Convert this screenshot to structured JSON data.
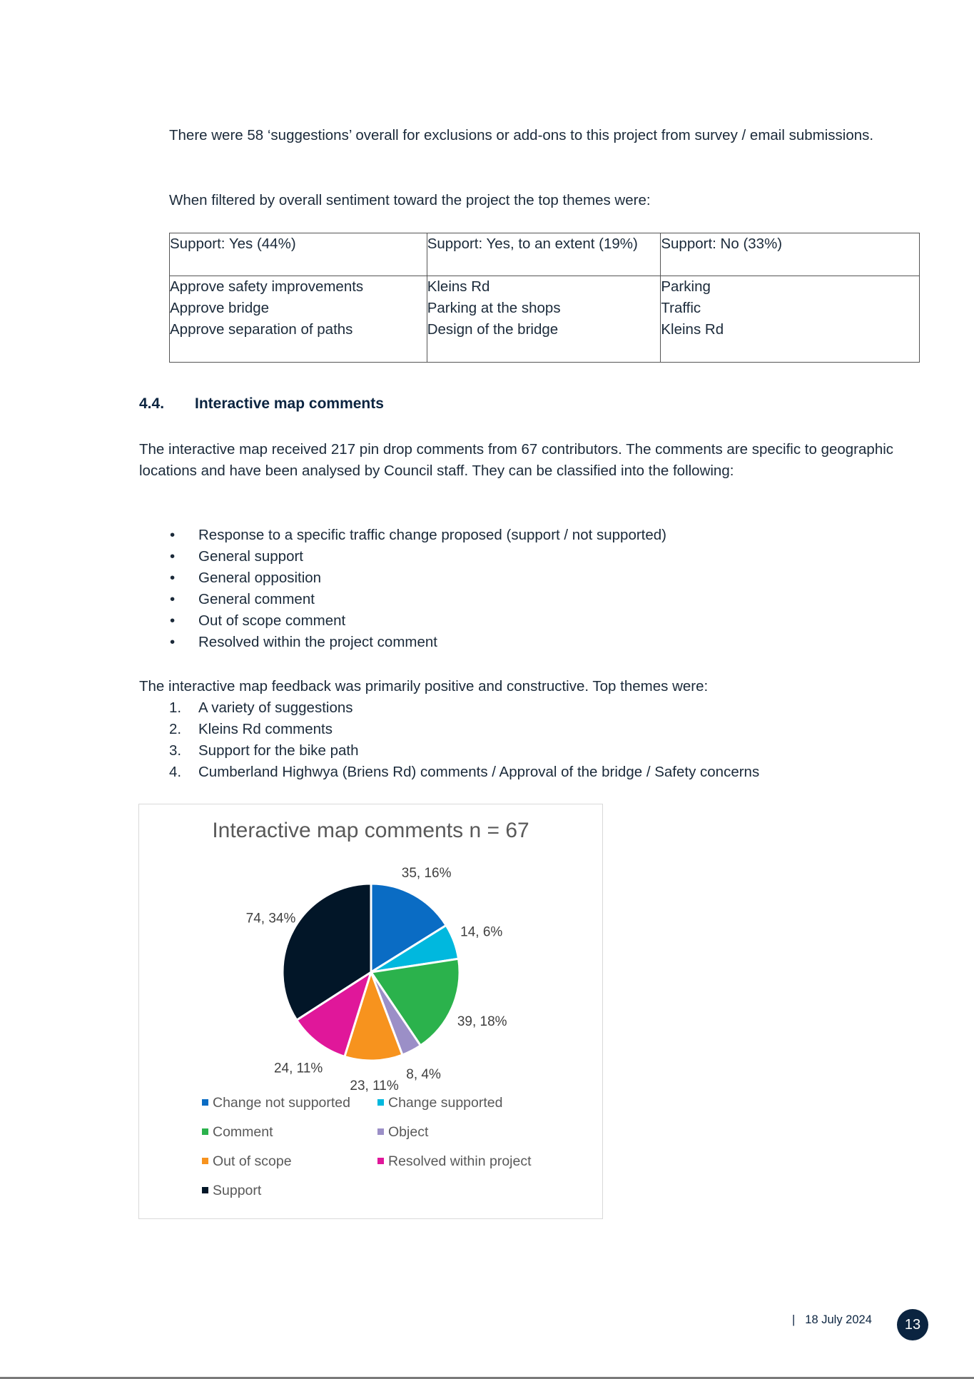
{
  "intro": {
    "paragraph1": "There were 58 ‘suggestions’ overall for exclusions or add-ons to this project from survey / email submissions.",
    "paragraph2": "When filtered by overall sentiment toward the project the top themes were:"
  },
  "themes_table": {
    "headers": [
      "Support: Yes (44%)",
      "Support: Yes, to an extent (19%)",
      "Support: No (33%)"
    ],
    "columns": [
      [
        "Approve safety improvements",
        "Approve bridge",
        "Approve separation of paths"
      ],
      [
        "Kleins Rd",
        "Parking at the shops",
        "Design of the bridge"
      ],
      [
        "Parking",
        "Traffic",
        "Kleins Rd"
      ]
    ]
  },
  "section": {
    "number": "4.4.",
    "title": "Interactive map comments",
    "paragraph": "The interactive map received 217 pin drop comments from 67 contributors. The comments are specific to geographic locations and have been analysed by Council staff. They can be classified into the following:",
    "bullet_glyph": "•",
    "bullets": [
      "Response to a specific traffic change proposed (support / not supported)",
      "General support",
      "General opposition",
      "General comment",
      "Out of scope comment",
      "Resolved within the project comment"
    ],
    "summary": "The interactive map feedback was primarily positive and constructive. Top themes were:",
    "top_themes": [
      {
        "num": "1.",
        "text": "A variety of suggestions"
      },
      {
        "num": "2.",
        "text": "Kleins Rd comments"
      },
      {
        "num": "3.",
        "text": "Support for the bike path"
      },
      {
        "num": "4.",
        "text": "Cumberland Highwya (Briens Rd) comments / Approval of the bridge / Safety concerns"
      }
    ]
  },
  "chart_data": {
    "type": "pie",
    "title": "Interactive map comments n = 67",
    "categories": [
      "Change not supported",
      "Change supported",
      "Comment",
      "Object",
      "Out of scope",
      "Resolved within project",
      "Support"
    ],
    "values": [
      35,
      14,
      39,
      8,
      23,
      24,
      74
    ],
    "percentages": [
      16,
      6,
      18,
      4,
      11,
      11,
      34
    ],
    "data_labels": [
      "35, 16%",
      "14, 6%",
      "39, 18%",
      "8, 4%",
      "23, 11%",
      "24, 11%",
      "74, 34%"
    ],
    "colors": [
      "#0a6cc4",
      "#00b8de",
      "#2bb24c",
      "#9b8fc7",
      "#f7931e",
      "#e0179a",
      "#021628"
    ],
    "start_angle": "12 o'clock, clockwise",
    "legend_position": "bottom",
    "legend_columns": 2
  },
  "footer": {
    "separator": "|",
    "date": "18 July 2024",
    "page_number": "13"
  }
}
